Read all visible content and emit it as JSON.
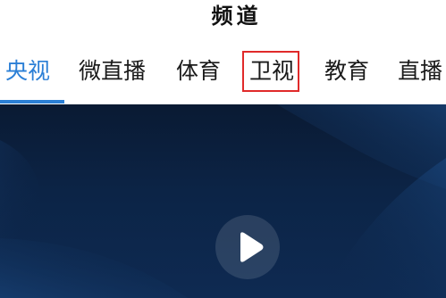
{
  "header": {
    "title": "频道"
  },
  "tabs": [
    {
      "label": "央视",
      "active": true
    },
    {
      "label": "微直播",
      "active": false
    },
    {
      "label": "体育",
      "active": false
    },
    {
      "label": "卫视",
      "active": false,
      "highlighted": true
    },
    {
      "label": "教育",
      "active": false
    },
    {
      "label": "直播",
      "active": false
    }
  ],
  "colors": {
    "accent": "#2b7fd6",
    "highlight_box": "#e02a2a",
    "player_bg": "#0c2446"
  },
  "player": {
    "play_icon": "play-icon"
  }
}
